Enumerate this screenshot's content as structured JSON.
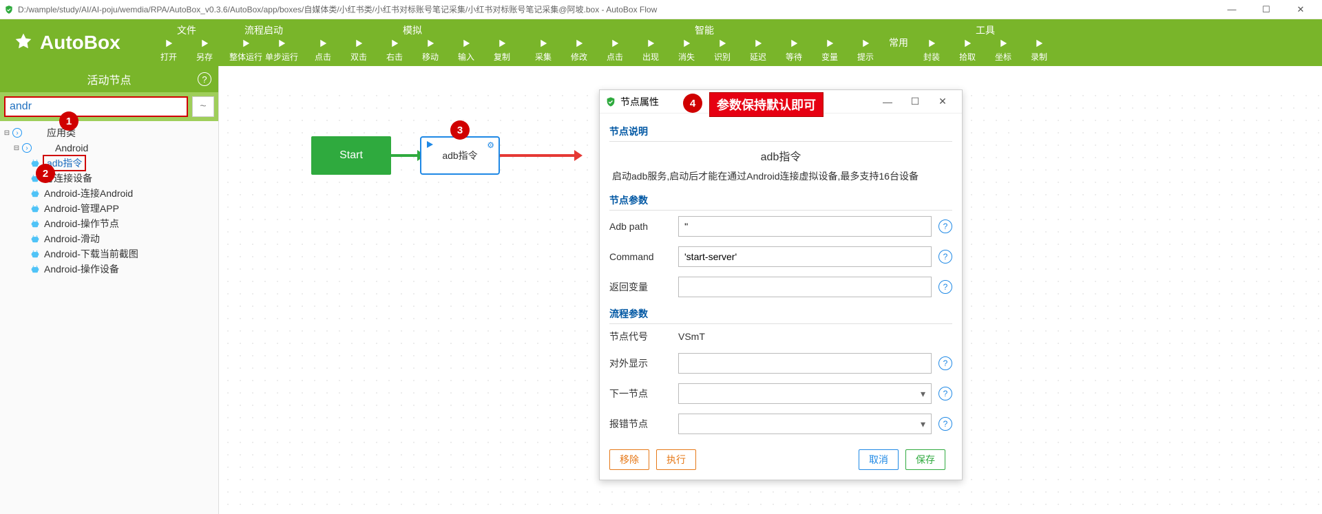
{
  "window": {
    "title": "D:/wample/study/AI/AI-poju/wemdia/RPA/AutoBox_v0.3.6/AutoBox/app/boxes/自媒体类/小红书类/小红书对标账号笔记采集/小红书对标账号笔记采集@阿坡.box - AutoBox Flow"
  },
  "logo": "AutoBox",
  "ribbon": [
    {
      "title": "文件",
      "buttons": [
        "打开",
        "另存"
      ]
    },
    {
      "title": "流程启动",
      "buttons": [
        "整体运行",
        "单步运行"
      ]
    },
    {
      "title": "模拟",
      "buttons": [
        "点击",
        "双击",
        "右击",
        "移动",
        "输入",
        "复制"
      ]
    },
    {
      "title": "智能",
      "buttons": [
        "采集",
        "修改",
        "点击",
        "出现",
        "消失",
        "识别",
        "延迟",
        "等待",
        "变量",
        "提示"
      ]
    },
    {
      "title": "常用",
      "buttons": []
    },
    {
      "title": "工具",
      "buttons": [
        "封装",
        "拾取",
        "坐标",
        "录制"
      ]
    }
  ],
  "sidebar": {
    "title": "活动节点",
    "search": "andr",
    "tilde": "~",
    "tree": {
      "root_label": "应用类",
      "group_label": "Android",
      "selected": "adb指令",
      "items": [
        "可连接设备",
        "Android-连接Android",
        "Android-管理APP",
        "Android-操作节点",
        "Android-滑动",
        "Android-下载当前截图",
        "Android-操作设备"
      ]
    }
  },
  "canvas": {
    "start": "Start",
    "adb": "adb指令"
  },
  "annotations": {
    "b1": "1",
    "b2": "2",
    "b3": "3",
    "b4": "4",
    "note": "参数保持默认即可"
  },
  "dialog": {
    "title": "节点属性",
    "sect_desc": "节点说明",
    "desc_title": "adb指令",
    "desc_text": "启动adb服务,启动后才能在通过Android连接虚拟设备,最多支持16台设备",
    "sect_params": "节点参数",
    "params": {
      "adb_path": {
        "label": "Adb path",
        "value": "''"
      },
      "command": {
        "label": "Command",
        "value": "'start-server'"
      },
      "retvar": {
        "label": "返回变量",
        "value": ""
      }
    },
    "sect_flow": "流程参数",
    "flow": {
      "id": {
        "label": "节点代号",
        "value": "VSmT"
      },
      "display": {
        "label": "对外显示",
        "value": ""
      },
      "next": {
        "label": "下一节点",
        "value": ""
      },
      "err": {
        "label": "报错节点",
        "value": ""
      }
    },
    "buttons": {
      "del": "移除",
      "run": "执行",
      "cancel": "取消",
      "save": "保存"
    }
  }
}
